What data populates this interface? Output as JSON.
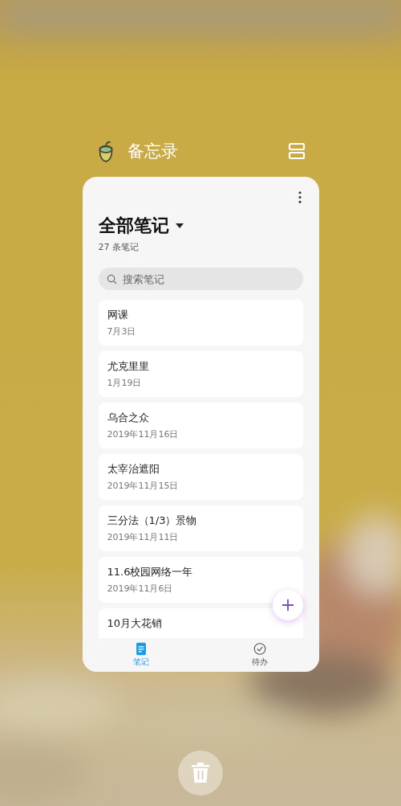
{
  "app_header": {
    "title": "备忘录"
  },
  "notes_header": {
    "title": "全部笔记",
    "count": "27 条笔记"
  },
  "search": {
    "placeholder": "搜索笔记"
  },
  "notes": [
    {
      "title": "网课",
      "date": "7月3日"
    },
    {
      "title": "尤克里里",
      "date": "1月19日"
    },
    {
      "title": "乌合之众",
      "date": "2019年11月16日"
    },
    {
      "title": "太宰治遮阳",
      "date": "2019年11月15日"
    },
    {
      "title": "三分法（1/3）景物",
      "date": "2019年11月11日"
    },
    {
      "title": "11.6校园网络一年",
      "date": "2019年11月6日"
    },
    {
      "title": "10月大花销"
    }
  ],
  "tabs": [
    {
      "label": "笔记",
      "kind": "notes",
      "selected": true
    },
    {
      "label": "待办",
      "kind": "todo",
      "selected": false
    }
  ]
}
